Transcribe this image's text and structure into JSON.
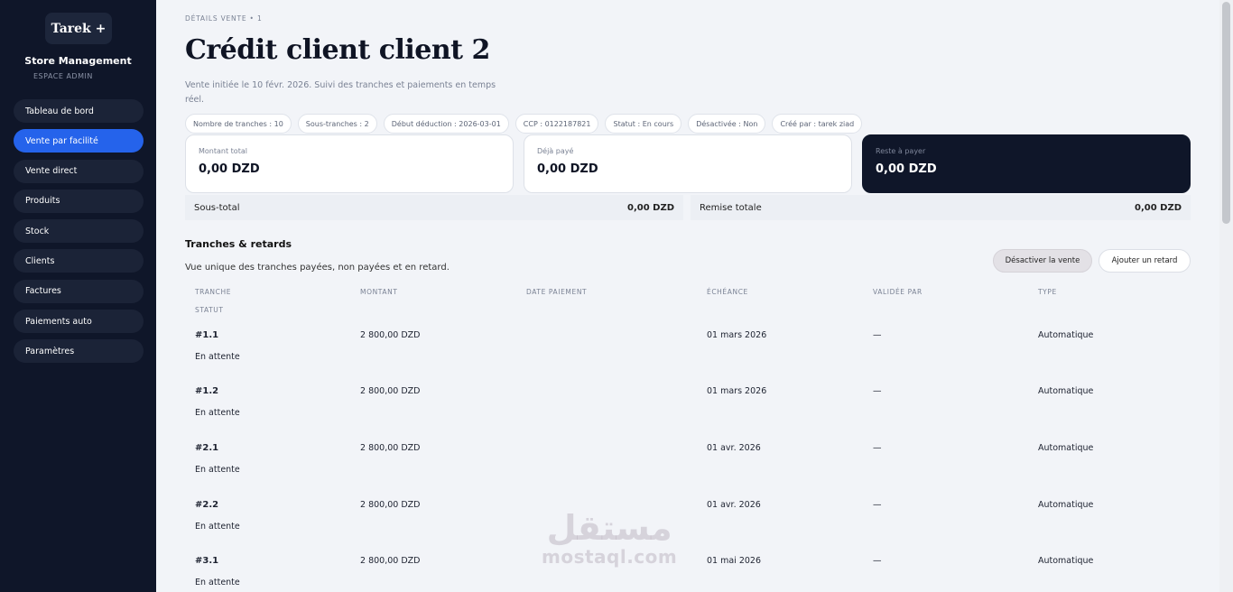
{
  "sidebar": {
    "brand": "Tarek +",
    "app_name": "Store Management",
    "space": "ESPACE ADMIN",
    "items": [
      {
        "label": "Tableau de bord",
        "active": false
      },
      {
        "label": "Vente par facilité",
        "active": true
      },
      {
        "label": "Vente direct",
        "active": false
      },
      {
        "label": "Produits",
        "active": false
      },
      {
        "label": "Stock",
        "active": false
      },
      {
        "label": "Clients",
        "active": false
      },
      {
        "label": "Factures",
        "active": false
      },
      {
        "label": "Paiements auto",
        "active": false
      },
      {
        "label": "Paramètres",
        "active": false
      }
    ]
  },
  "header": {
    "breadcrumb": "DÉTAILS VENTE • 1",
    "title": "Crédit client client 2",
    "description": "Vente initiée le 10 févr. 2026. Suivi des tranches et paiements en temps réel."
  },
  "pills": [
    "Nombre de tranches : 10",
    "Sous-tranches : 2",
    "Début déduction : 2026-03-01",
    "CCP : 0122187821",
    "Statut : En cours",
    "Désactivée : Non",
    "Créé par : tarek ziad"
  ],
  "cards": {
    "total": {
      "label": "Montant total",
      "value": "0,00 DZD"
    },
    "paid": {
      "label": "Déjà payé",
      "value": "0,00 DZD"
    },
    "remaining": {
      "label": "Reste à payer",
      "value": "0,00 DZD"
    }
  },
  "totals": {
    "subtotal_label": "Sous-total",
    "subtotal_value": "0,00 DZD",
    "discount_label": "Remise totale",
    "discount_value": "0,00 DZD"
  },
  "section": {
    "title": "Tranches & retards",
    "subtitle": "Vue unique des tranches payées, non payées et en retard.",
    "deactivate_label": "Désactiver la vente",
    "add_delay_label": "Ajouter un retard"
  },
  "table": {
    "headers": [
      "TRANCHE",
      "MONTANT",
      "DATE PAIEMENT",
      "ÉCHÉANCE",
      "VALIDÉE PAR",
      "TYPE",
      "STATUT"
    ],
    "rows": [
      {
        "tranche": "#1.1",
        "montant": "2 800,00 DZD",
        "date": "",
        "echeance": "01 mars 2026",
        "validee": "—",
        "type": "Automatique",
        "statut": "En attente"
      },
      {
        "tranche": "#1.2",
        "montant": "2 800,00 DZD",
        "date": "",
        "echeance": "01 mars 2026",
        "validee": "—",
        "type": "Automatique",
        "statut": "En attente"
      },
      {
        "tranche": "#2.1",
        "montant": "2 800,00 DZD",
        "date": "",
        "echeance": "01 avr. 2026",
        "validee": "—",
        "type": "Automatique",
        "statut": "En attente"
      },
      {
        "tranche": "#2.2",
        "montant": "2 800,00 DZD",
        "date": "",
        "echeance": "01 avr. 2026",
        "validee": "—",
        "type": "Automatique",
        "statut": "En attente"
      },
      {
        "tranche": "#3.1",
        "montant": "2 800,00 DZD",
        "date": "",
        "echeance": "01 mai 2026",
        "validee": "—",
        "type": "Automatique",
        "statut": "En attente"
      }
    ]
  },
  "watermark": {
    "arabic": "مستقل",
    "latin": "mostaql.com"
  }
}
